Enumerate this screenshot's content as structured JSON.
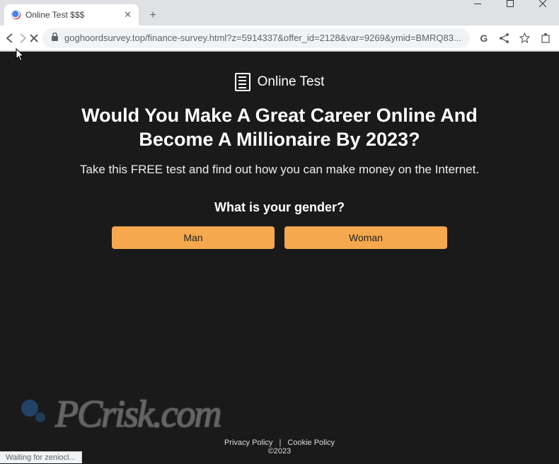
{
  "browser": {
    "tab_title": "Online Test $$$",
    "url": "goghoordsurvey.top/finance-survey.html?z=5914337&offer_id=2128&var=9269&ymid=BMRQ83...",
    "status_text": "Waiting for zeniocl..."
  },
  "page": {
    "brand": "Online Test",
    "headline": "Would You Make A Great Career Online And Become A Millionaire By 2023?",
    "subhead": "Take this FREE test and find out how you can make money on the Internet.",
    "question": "What is your gender?",
    "answers": {
      "option1": "Man",
      "option2": "Woman"
    },
    "footer": {
      "privacy": "Privacy Policy",
      "cookie": "Cookie Policy",
      "copyright": "©2023"
    }
  },
  "watermark": {
    "text": "PCrisk.com"
  }
}
